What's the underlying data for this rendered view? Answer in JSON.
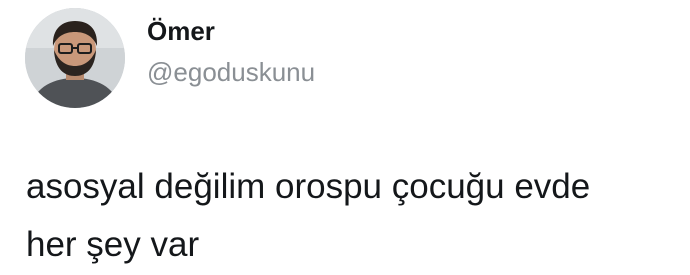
{
  "tweet": {
    "author": {
      "display_name": "Ömer",
      "handle": "@egoduskunu",
      "avatar_icon": "profile-photo"
    },
    "text_lines": [
      "asosyal değilim orospu çocuğu evde",
      "her şey var"
    ]
  }
}
